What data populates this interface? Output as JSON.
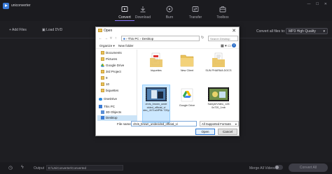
{
  "app": {
    "name": "uniconverter",
    "window_controls": "— ☐ ✕"
  },
  "nav_tabs": [
    {
      "label": "Convert",
      "active": true
    },
    {
      "label": "Download",
      "active": false
    },
    {
      "label": "Burn",
      "active": false
    },
    {
      "label": "Transfer",
      "active": false
    },
    {
      "label": "Toolbox",
      "active": false
    }
  ],
  "toolbar": {
    "add_files": "+ Add Files",
    "load_dvd": "▣ Load DVD",
    "convert_all_label": "Convert all files to:",
    "format_value": "MP3 High Quality"
  },
  "bottom": {
    "output_label": "Output",
    "output_path": "E:\\UniConverter\\Converted",
    "merge_label": "Merge All Videos",
    "convert_all_button": "Convert All"
  },
  "dialog": {
    "title": "Open",
    "close": "✕",
    "address": {
      "this_pc": "This PC",
      "sep": "›",
      "folder": "Desktop"
    },
    "search_placeholder": "Search Desktop",
    "commands": {
      "organize": "Organize ▾",
      "new_folder": "New folder"
    },
    "nav_items": [
      {
        "label": "Documents",
        "icon": "folder-icon"
      },
      {
        "label": "Pictures",
        "icon": "folder-icon"
      },
      {
        "label": "Google Drive",
        "icon": "google-drive-icon"
      },
      {
        "label": "3rd Project",
        "icon": "folder-icon"
      },
      {
        "label": "9",
        "icon": "folder-icon"
      },
      {
        "label": "10",
        "icon": "folder-icon"
      },
      {
        "label": "biquettes",
        "icon": "folder-icon"
      },
      {
        "label": "OneDrive",
        "icon": "cloud-icon"
      },
      {
        "label": "This PC",
        "icon": "computer-icon"
      },
      {
        "label": "3D Objects",
        "icon": "folder-icon"
      },
      {
        "label": "Desktop",
        "icon": "folder-icon",
        "selected": true
      }
    ],
    "files": [
      {
        "name": "biquettes",
        "kind": "folder-doc"
      },
      {
        "name": "New Client",
        "kind": "folder"
      },
      {
        "name": "SUN PHARMA DOCS",
        "kind": "folder-doc"
      },
      {
        "name": "chris_brown_unde cided_official_vi deo_J47Ls0iP9k 720p",
        "kind": "video",
        "selected": true
      },
      {
        "name": "Google Drive",
        "kind": "drive"
      },
      {
        "name": "SampleVideo_128 0x720_1mb",
        "kind": "video2"
      }
    ],
    "file_name_label": "File name:",
    "file_name_value": "chris_brown_undecided_official_vi",
    "filter_value": "All Supported Formats",
    "open_button": "Open",
    "cancel_button": "Cancel"
  },
  "colors": {
    "accent": "#8a77ff",
    "dialog_select": "#cce4f7",
    "folder": "#e9c15a"
  }
}
